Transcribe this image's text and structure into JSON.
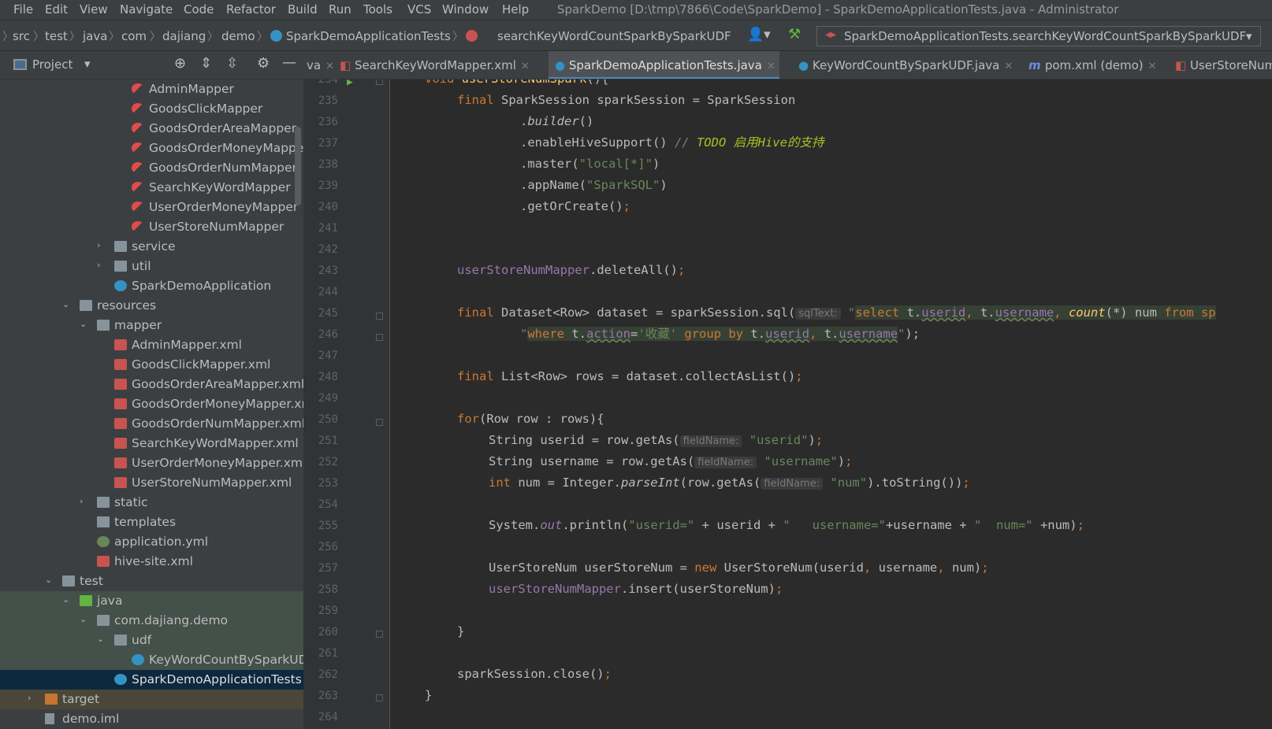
{
  "menu": [
    "File",
    "Edit",
    "View",
    "Navigate",
    "Code",
    "Refactor",
    "Build",
    "Run",
    "Tools",
    "VCS",
    "Window",
    "Help"
  ],
  "window_title": "SparkDemo [D:\\tmp\\7866\\Code\\SparkDemo] - SparkDemoApplicationTests.java - Administrator",
  "breadcrumbs": [
    "src",
    "test",
    "java",
    "com",
    "dajiang",
    "demo",
    "SparkDemoApplicationTests",
    "searchKeyWordCountSparkBySparkUDF"
  ],
  "run_config": "SparkDemoApplicationTests.searchKeyWordCountSparkBySparkUDF",
  "project_panel": {
    "title": "Project"
  },
  "tabs": [
    {
      "label": "va"
    },
    {
      "label": "SearchKeyWordMapper.xml"
    },
    {
      "label": "SparkDemoApplicationTests.java",
      "active": true
    },
    {
      "label": "KeyWordCountBySparkUDF.java"
    },
    {
      "label": "pom.xml (demo)"
    },
    {
      "label": "UserStoreNum"
    }
  ],
  "tree": [
    {
      "label": "AdminMapper"
    },
    {
      "label": "GoodsClickMapper"
    },
    {
      "label": "GoodsOrderAreaMapper"
    },
    {
      "label": "GoodsOrderMoneyMapper"
    },
    {
      "label": "GoodsOrderNumMapper"
    },
    {
      "label": "SearchKeyWordMapper"
    },
    {
      "label": "UserOrderMoneyMapper"
    },
    {
      "label": "UserStoreNumMapper"
    },
    {
      "label": "service"
    },
    {
      "label": "util"
    },
    {
      "label": "SparkDemoApplication"
    },
    {
      "label": "resources"
    },
    {
      "label": "mapper"
    },
    {
      "label": "AdminMapper.xml"
    },
    {
      "label": "GoodsClickMapper.xml"
    },
    {
      "label": "GoodsOrderAreaMapper.xml"
    },
    {
      "label": "GoodsOrderMoneyMapper.xml"
    },
    {
      "label": "GoodsOrderNumMapper.xml"
    },
    {
      "label": "SearchKeyWordMapper.xml"
    },
    {
      "label": "UserOrderMoneyMapper.xml"
    },
    {
      "label": "UserStoreNumMapper.xml"
    },
    {
      "label": "static"
    },
    {
      "label": "templates"
    },
    {
      "label": "application.yml"
    },
    {
      "label": "hive-site.xml"
    },
    {
      "label": "test"
    },
    {
      "label": "java"
    },
    {
      "label": "com.dajiang.demo"
    },
    {
      "label": "udf"
    },
    {
      "label": "KeyWordCountBySparkUDF"
    },
    {
      "label": "SparkDemoApplicationTests"
    },
    {
      "label": "target"
    },
    {
      "label": "demo.iml"
    }
  ],
  "line_numbers": [
    "234",
    "235",
    "236",
    "237",
    "238",
    "239",
    "240",
    "241",
    "242",
    "243",
    "244",
    "245",
    "246",
    "247",
    "248",
    "249",
    "250",
    "251",
    "252",
    "253",
    "254",
    "255",
    "256",
    "257",
    "258",
    "259",
    "260",
    "261",
    "262",
    "263",
    "264"
  ],
  "code": {
    "l234": [
      "void ",
      "userStoreNumSpark",
      "(){"
    ],
    "l235": [
      "final ",
      "SparkSession sparkSession = SparkSession"
    ],
    "l236": [
      ".",
      "builder",
      "()"
    ],
    "l237": [
      ".enableHiveSupport() ",
      "// ",
      "TODO 启用Hive的支持"
    ],
    "l238": [
      ".master(",
      "\"local[*]\"",
      ")"
    ],
    "l239": [
      ".appName(",
      "\"SparkSQL\"",
      ")"
    ],
    "l240": [
      ".getOrCreate()",
      ";"
    ],
    "l243": [
      "userStoreNumMapper",
      ".deleteAll()",
      ";"
    ],
    "l245": [
      "final ",
      "Dataset<Row> dataset = sparkSession.sql(",
      "sqlText:",
      " \"",
      "select",
      " t.",
      "userid",
      ",",
      " t.",
      "username",
      ",",
      " count",
      "(*)",
      " num ",
      "from",
      " sp"
    ],
    "l246": [
      "\"",
      "where",
      " t.",
      "action",
      "=",
      "'收藏'",
      " group by",
      " t.",
      "userid",
      ",",
      " t.",
      "username",
      "\"",
      ");"
    ],
    "l248": [
      "final ",
      "List<Row> rows = dataset.collectAsList()",
      ";"
    ],
    "l250": [
      "for",
      "(Row row : rows){"
    ],
    "l251": [
      "String userid = row.getAs(",
      "fieldName:",
      " \"userid\"",
      ")",
      ";"
    ],
    "l252": [
      "String username = row.getAs(",
      "fieldName:",
      " \"username\"",
      ")",
      ";"
    ],
    "l253": [
      "int ",
      "num = Integer.",
      "parseInt",
      "(row.getAs(",
      "fieldName:",
      " \"num\"",
      ").toString())",
      ";"
    ],
    "l255": [
      "System.",
      "out",
      ".println(",
      "\"userid=\"",
      " + userid + ",
      "\"   username=\"",
      "+username + ",
      "\"  num=\"",
      " +num)",
      ";"
    ],
    "l257": [
      "UserStoreNum userStoreNum = ",
      "new ",
      "UserStoreNum(userid",
      ", ",
      "username",
      ", ",
      "num)",
      ";"
    ],
    "l258": [
      "userStoreNumMapper",
      ".insert(userStoreNum)",
      ";"
    ],
    "l260": [
      "}"
    ],
    "l262": [
      "sparkSession.close()",
      ";"
    ],
    "l263": [
      "}"
    ]
  }
}
